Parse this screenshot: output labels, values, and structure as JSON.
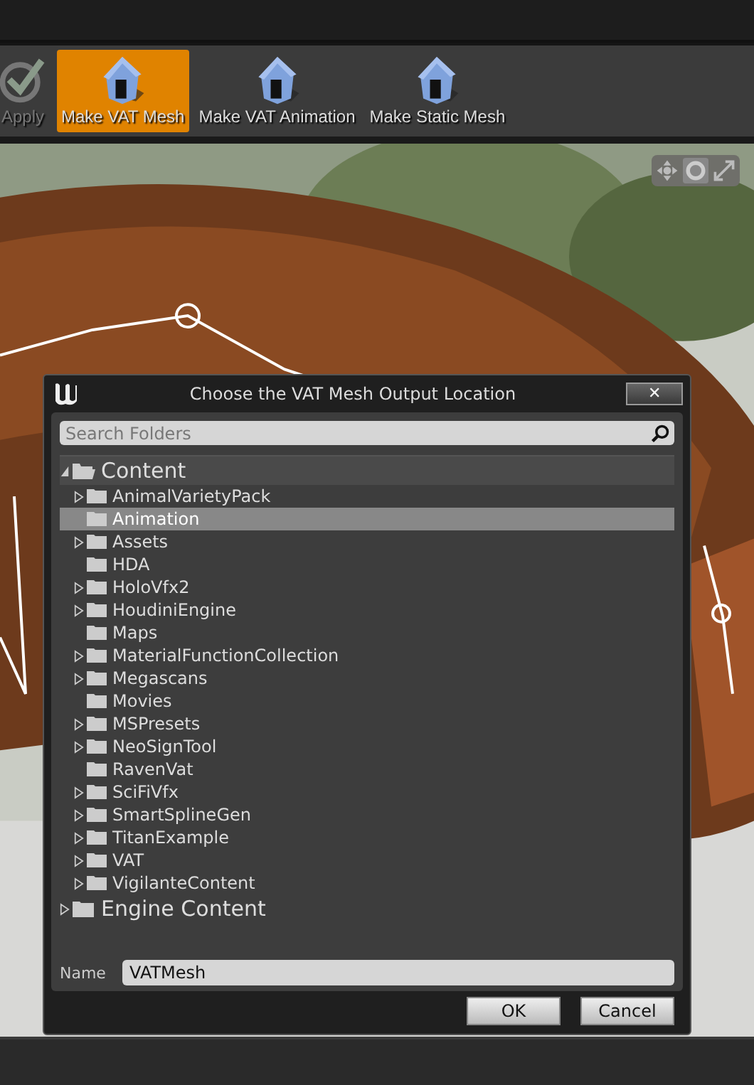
{
  "toolbar": {
    "buttons": [
      {
        "label": "Apply",
        "selected": false,
        "disabled": true,
        "kind": "check"
      },
      {
        "label": "Make VAT Mesh",
        "selected": true,
        "disabled": false,
        "kind": "house"
      },
      {
        "label": "Make VAT Animation",
        "selected": false,
        "disabled": false,
        "kind": "house"
      },
      {
        "label": "Make Static Mesh",
        "selected": false,
        "disabled": false,
        "kind": "house"
      }
    ]
  },
  "dialog": {
    "title": "Choose the VAT Mesh Output Location",
    "close": "✕",
    "search": {
      "placeholder": "Search Folders"
    },
    "tree": [
      {
        "label": "Content",
        "expanded": true,
        "selected": false,
        "children": [
          {
            "label": "AnimalVarietyPack",
            "has_children": true,
            "selected": false
          },
          {
            "label": "Animation",
            "has_children": false,
            "selected": true
          },
          {
            "label": "Assets",
            "has_children": true,
            "selected": false
          },
          {
            "label": "HDA",
            "has_children": false,
            "selected": false
          },
          {
            "label": "HoloVfx2",
            "has_children": true,
            "selected": false
          },
          {
            "label": "HoudiniEngine",
            "has_children": true,
            "selected": false
          },
          {
            "label": "Maps",
            "has_children": false,
            "selected": false
          },
          {
            "label": "MaterialFunctionCollection",
            "has_children": true,
            "selected": false
          },
          {
            "label": "Megascans",
            "has_children": true,
            "selected": false
          },
          {
            "label": "Movies",
            "has_children": false,
            "selected": false
          },
          {
            "label": "MSPresets",
            "has_children": true,
            "selected": false
          },
          {
            "label": "NeoSignTool",
            "has_children": true,
            "selected": false
          },
          {
            "label": "RavenVat",
            "has_children": false,
            "selected": false
          },
          {
            "label": "SciFiVfx",
            "has_children": true,
            "selected": false
          },
          {
            "label": "SmartSplineGen",
            "has_children": true,
            "selected": false
          },
          {
            "label": "TitanExample",
            "has_children": true,
            "selected": false
          },
          {
            "label": "VAT",
            "has_children": true,
            "selected": false
          },
          {
            "label": "VigilanteContent",
            "has_children": true,
            "selected": false
          }
        ]
      },
      {
        "label": "Engine Content",
        "expanded": false,
        "has_children": true,
        "selected": false
      }
    ],
    "name_label": "Name",
    "name_value": "VATMesh",
    "buttons": [
      "OK",
      "Cancel"
    ]
  }
}
